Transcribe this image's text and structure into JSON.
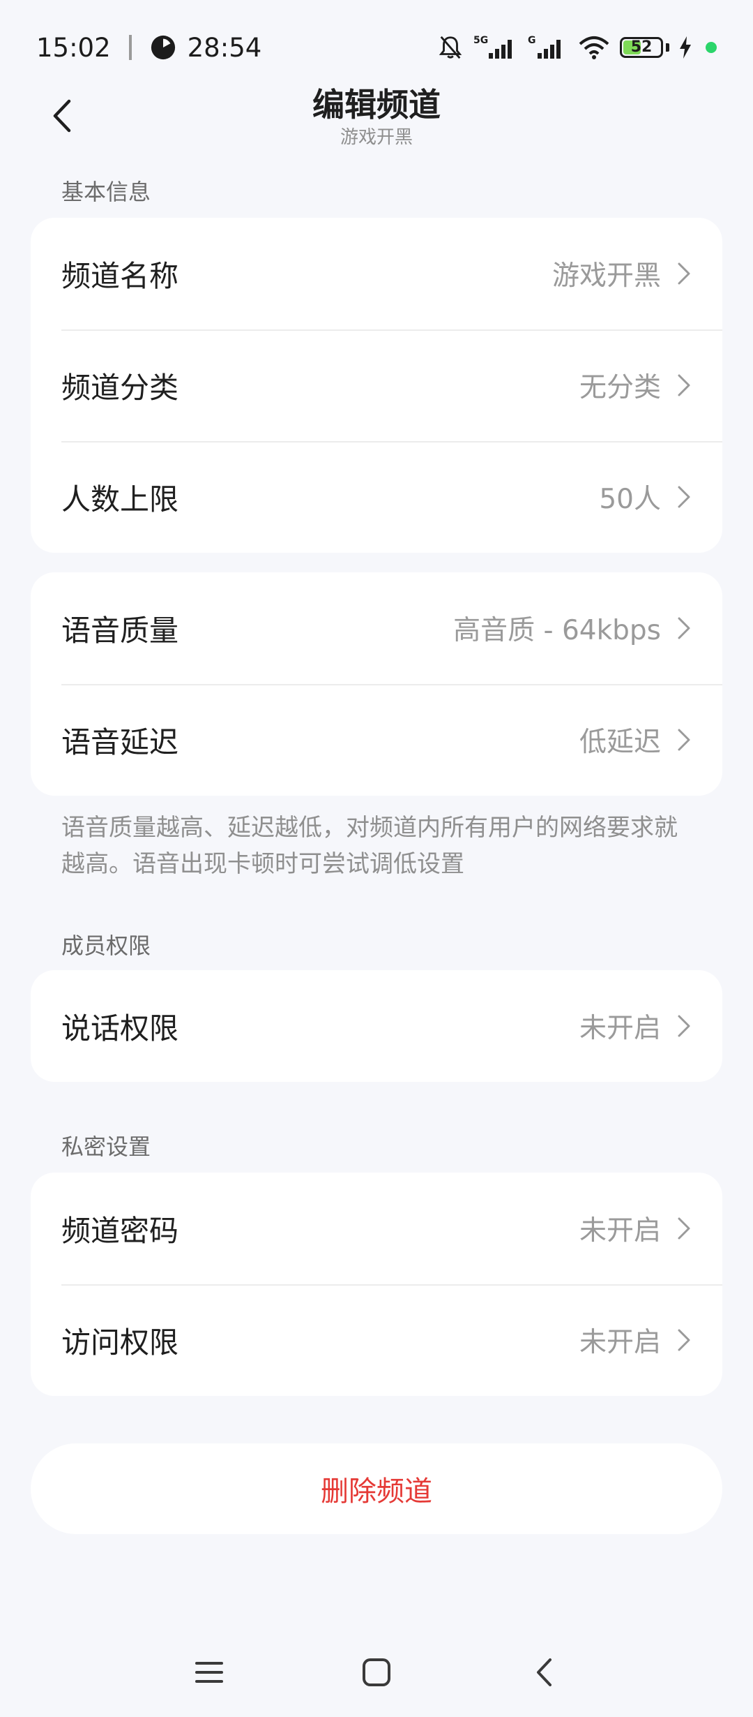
{
  "status_bar": {
    "time": "15:02",
    "timer": "28:54",
    "battery_level": "52",
    "network_5g": "5G",
    "network_g": "G"
  },
  "header": {
    "title": "编辑频道",
    "subtitle": "游戏开黑"
  },
  "sections": {
    "basic": {
      "label": "基本信息",
      "rows": [
        {
          "label": "频道名称",
          "value": "游戏开黑"
        },
        {
          "label": "频道分类",
          "value": "无分类"
        },
        {
          "label": "人数上限",
          "value": "50人"
        }
      ]
    },
    "voice": {
      "rows": [
        {
          "label": "语音质量",
          "value": "高音质 - 64kbps"
        },
        {
          "label": "语音延迟",
          "value": "低延迟"
        }
      ],
      "note": "语音质量越高、延迟越低，对频道内所有用户的网络要求就越高。语音出现卡顿时可尝试调低设置"
    },
    "members": {
      "label": "成员权限",
      "rows": [
        {
          "label": "说话权限",
          "value": "未开启"
        }
      ]
    },
    "privacy": {
      "label": "私密设置",
      "rows": [
        {
          "label": "频道密码",
          "value": "未开启"
        },
        {
          "label": "访问权限",
          "value": "未开启"
        }
      ]
    }
  },
  "actions": {
    "delete_label": "删除频道"
  },
  "colors": {
    "background": "#f6f7fb",
    "card": "#ffffff",
    "danger": "#e53935",
    "secondary_text": "#9a9a9a"
  }
}
